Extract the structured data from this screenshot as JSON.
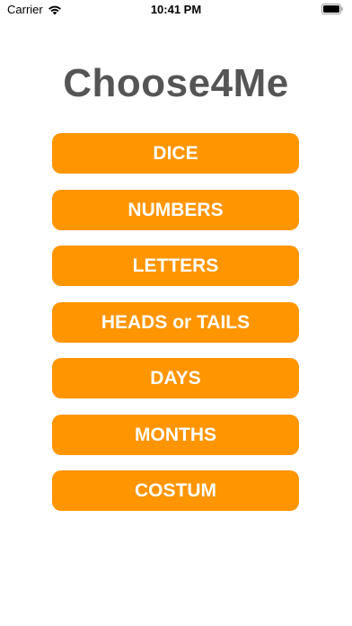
{
  "status_bar": {
    "carrier": "Carrier",
    "time": "10:41 PM"
  },
  "app": {
    "title": "Choose4Me"
  },
  "buttons": [
    {
      "label": "DICE"
    },
    {
      "label": "NUMBERS"
    },
    {
      "label": "LETTERS"
    },
    {
      "label": "HEADS or TAILS"
    },
    {
      "label": "DAYS"
    },
    {
      "label": "MONTHS"
    },
    {
      "label": "COSTUM"
    }
  ],
  "colors": {
    "accent": "#FF9500",
    "title": "#555555",
    "button_text": "#FFFFFF",
    "background": "#FFFFFF"
  }
}
